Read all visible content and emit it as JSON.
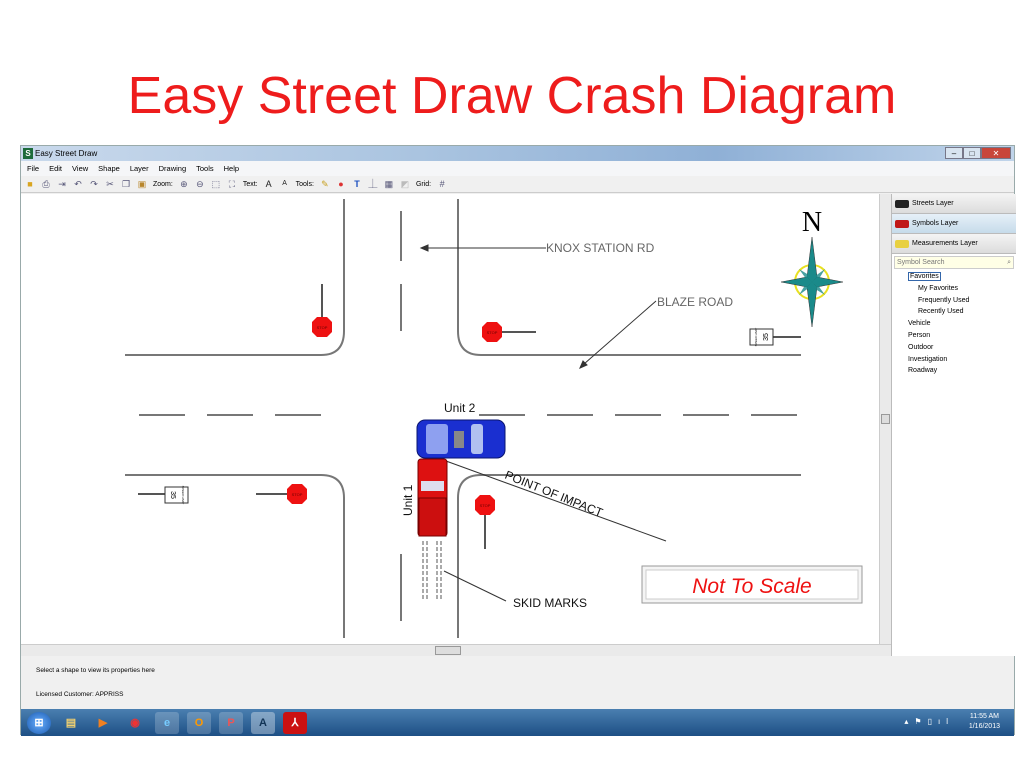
{
  "slide": {
    "title": "Easy Street Draw Crash Diagram"
  },
  "window": {
    "title": "Easy Street Draw",
    "logo": "S"
  },
  "menu": [
    "File",
    "Edit",
    "View",
    "Shape",
    "Layer",
    "Drawing",
    "Tools",
    "Help"
  ],
  "toolbar": {
    "zoom_label": "Zoom:",
    "text_label": "Text:",
    "tools_label": "Tools:",
    "grid_label": "Grid:",
    "grid_icon": "#"
  },
  "diagram": {
    "street1": "KNOX STATION RD",
    "street2": "BLAZE ROAD",
    "unit1": "Unit 1",
    "unit2": "Unit 2",
    "impact": "POINT OF IMPACT",
    "skid": "SKID MARKS",
    "scale_note": "Not To Scale",
    "north": "N",
    "stop": "STOP",
    "speed": "35",
    "speed_caption": "SPEED LIMIT",
    "colors": {
      "unit1": "#dd1111",
      "unit2": "#1a2fd0",
      "stop": "#ee1111",
      "compass": "#1a8a8a",
      "note": "#ee1111"
    }
  },
  "panel": {
    "layers": [
      "Streets Layer",
      "Symbols Layer",
      "Measurements Layer"
    ],
    "search_placeholder": "Symbol Search",
    "tree": {
      "root": "Favorites",
      "children": [
        "My Favorites",
        "Frequently Used",
        "Recently Used"
      ],
      "categories": [
        "Vehicle",
        "Person",
        "Outdoor",
        "Investigation",
        "Roadway"
      ]
    }
  },
  "status": {
    "hint": "Select a shape to view its properties here",
    "license": "Licensed Customer: APPRISS"
  },
  "taskbar": {
    "time": "11:55 AM",
    "date": "1/16/2013"
  }
}
